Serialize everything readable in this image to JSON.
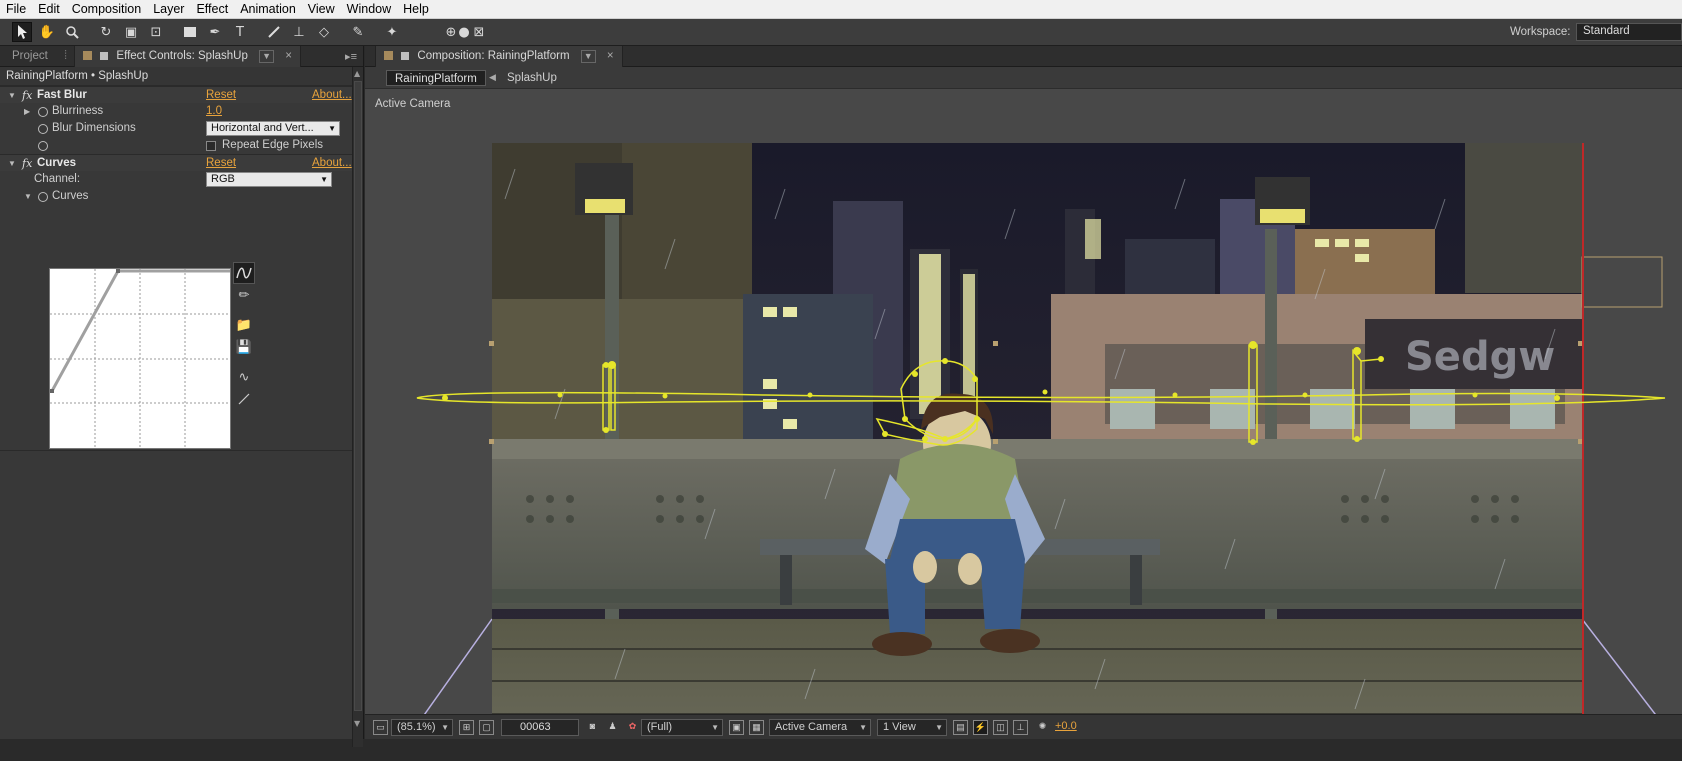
{
  "menu": [
    "File",
    "Edit",
    "Composition",
    "Layer",
    "Effect",
    "Animation",
    "View",
    "Window",
    "Help"
  ],
  "toolbar": {
    "workspace_label": "Workspace:",
    "workspace_value": "Standard"
  },
  "left_panel": {
    "tabs": {
      "project": "Project",
      "effect_controls": "Effect Controls: SplashUp"
    },
    "header": "RainingPlatform • SplashUp",
    "effects": {
      "fast_blur": {
        "name": "Fast Blur",
        "reset": "Reset",
        "about": "About...",
        "blurriness_label": "Blurriness",
        "blurriness_value": "1.0",
        "blur_dimensions_label": "Blur Dimensions",
        "blur_dimensions_value": "Horizontal and Vert...",
        "repeat_edge_label": "Repeat Edge Pixels"
      },
      "curves": {
        "name": "Curves",
        "reset": "Reset",
        "about": "About...",
        "channel_label": "Channel:",
        "channel_value": "RGB",
        "curves_label": "Curves"
      }
    }
  },
  "comp_panel": {
    "tab": "Composition: RainingPlatform",
    "breadcrumbs": [
      "RainingPlatform",
      "SplashUp"
    ],
    "view_label": "Active Camera",
    "sign_text": "Sedgw",
    "bottom": {
      "zoom": "(85.1%)",
      "timecode": "00063",
      "resolution": "(Full)",
      "camera": "Active Camera",
      "views": "1 View",
      "exposure": "+0.0"
    }
  },
  "colors": {
    "accent_orange": "#e8a33c",
    "mask_yellow": "#e6e62a",
    "panel_bg": "#383838",
    "comp_bg": "#484848"
  }
}
